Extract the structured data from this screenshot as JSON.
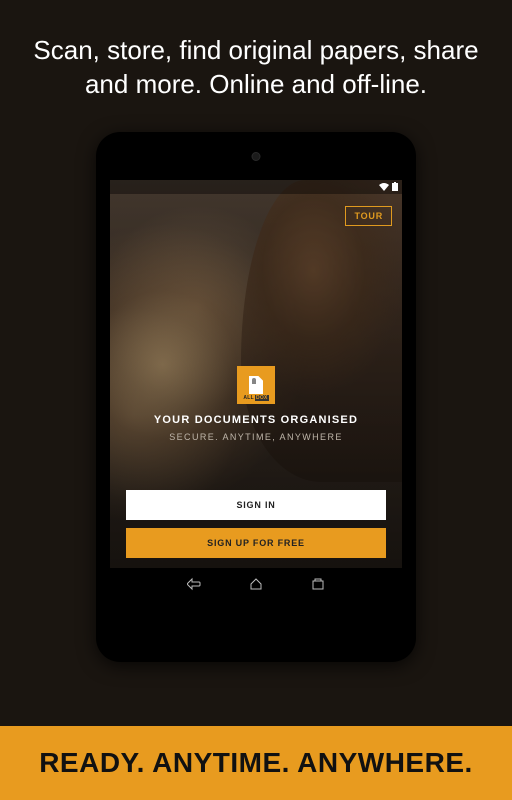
{
  "hero": "Scan, store, find original papers, share and more. Online and off-line.",
  "screen": {
    "tour_label": "TOUR",
    "logo_text_a": "ALL",
    "logo_text_b": "DOX",
    "headline": "YOUR DOCUMENTS ORGANISED",
    "subline": "SECURE. ANYTIME, ANYWHERE",
    "signin_label": "SIGN IN",
    "signup_label": "SIGN UP FOR FREE"
  },
  "footer": "READY. ANYTIME. ANYWHERE."
}
